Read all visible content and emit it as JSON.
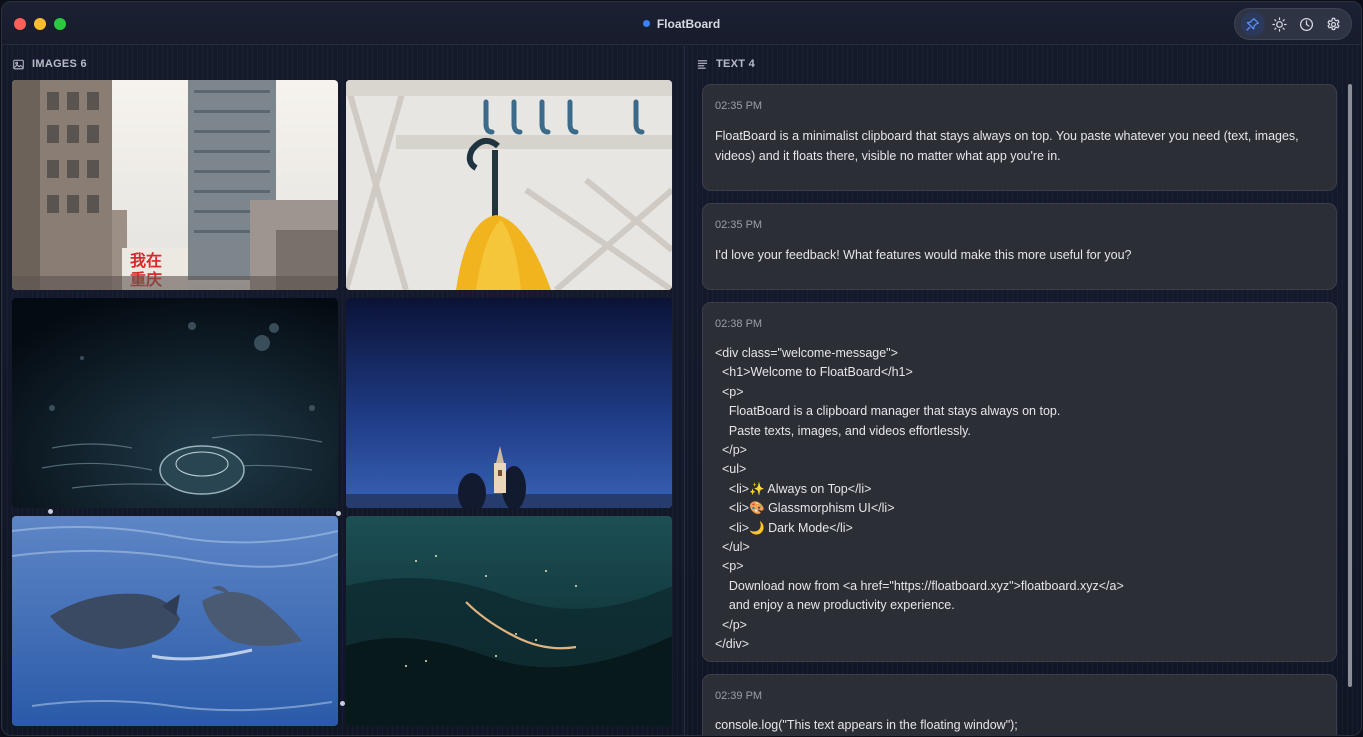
{
  "window": {
    "title": "FloatBoard"
  },
  "toolbar": {
    "buttons": [
      {
        "name": "pin-icon",
        "active": true
      },
      {
        "name": "sun-icon",
        "active": false
      },
      {
        "name": "clock-icon",
        "active": false
      },
      {
        "name": "gear-icon",
        "active": false
      }
    ]
  },
  "images": {
    "label": "IMAGES 6",
    "items": [
      {
        "subject": "city-street-buildings",
        "sign_text": "我在\n重庆"
      },
      {
        "subject": "umbrella-on-hooks"
      },
      {
        "subject": "water-droplet"
      },
      {
        "subject": "church-at-night"
      },
      {
        "subject": "dolphins-in-water"
      },
      {
        "subject": "night-road-aerial"
      }
    ]
  },
  "texts": {
    "label": "TEXT 4",
    "cards": [
      {
        "time": "02:35 PM",
        "content": "FloatBoard is a minimalist clipboard that stays always on top. You paste whatever you need (text, images, videos) and it floats there, visible no matter what app you're in."
      },
      {
        "time": "02:35 PM",
        "content": "I'd love your feedback! What features would make this more useful for you?"
      },
      {
        "time": "02:38 PM",
        "content": "<div class=\"welcome-message\">\n  <h1>Welcome to FloatBoard</h1>\n  <p>\n    FloatBoard is a clipboard manager that stays always on top.\n    Paste texts, images, and videos effortlessly.\n  </p>\n  <ul>\n    <li>✨ Always on Top</li>\n    <li>🎨 Glassmorphism UI</li>\n    <li>🌙 Dark Mode</li>\n  </ul>\n  <p>\n    Download now from <a href=\"https://floatboard.xyz\">floatboard.xyz</a>\n    and enjoy a new productivity experience.\n  </p>\n</div>"
      },
      {
        "time": "02:39 PM",
        "content": "console.log(\"This text appears in the floating window\");"
      }
    ]
  }
}
